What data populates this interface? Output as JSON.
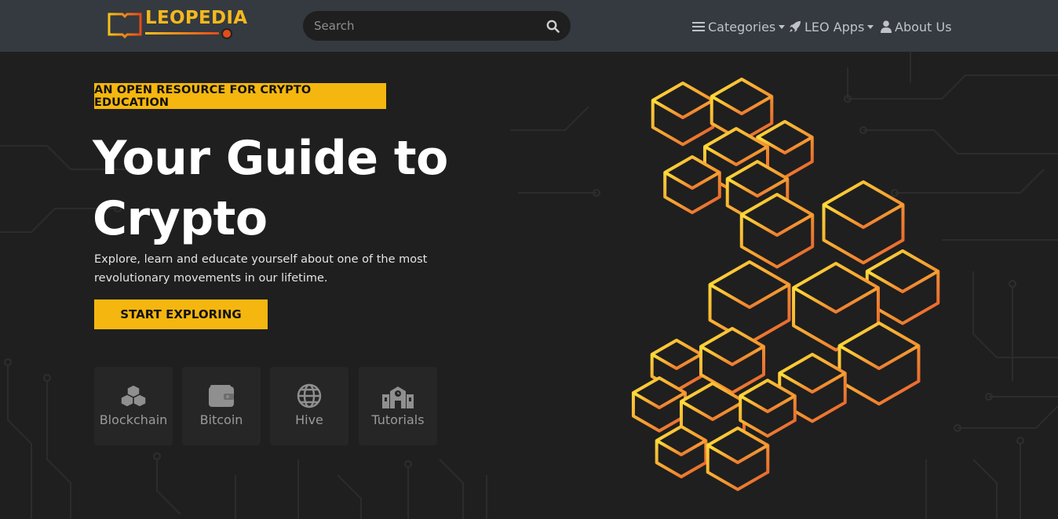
{
  "brand": {
    "name": "LEOPEDIA"
  },
  "search": {
    "placeholder": "Search"
  },
  "nav": [
    {
      "label": "Categories",
      "icon": "menu-icon",
      "dropdown": true
    },
    {
      "label": "LEO Apps",
      "icon": "rocket-icon",
      "dropdown": true
    },
    {
      "label": "About Us",
      "icon": "user-icon",
      "dropdown": false
    }
  ],
  "hero": {
    "badge": "AN OPEN RESOURCE FOR CRYPTO EDUCATION",
    "title_line1": "Your Guide to",
    "title_line2": "Crypto",
    "subtitle_line1": "Explore, learn and educate yourself about one of the most",
    "subtitle_line2": "revolutionary movements in our lifetime.",
    "cta": "START EXPLORING"
  },
  "categories": [
    {
      "label": "Blockchain",
      "icon": "cubes-icon"
    },
    {
      "label": "Bitcoin",
      "icon": "wallet-icon"
    },
    {
      "label": "Hive",
      "icon": "globe-icon"
    },
    {
      "label": "Tutorials",
      "icon": "school-icon"
    }
  ],
  "colors": {
    "accent": "#f5b70f",
    "navbar": "#343a40",
    "background": "#1f1f1f",
    "card": "#262626"
  }
}
